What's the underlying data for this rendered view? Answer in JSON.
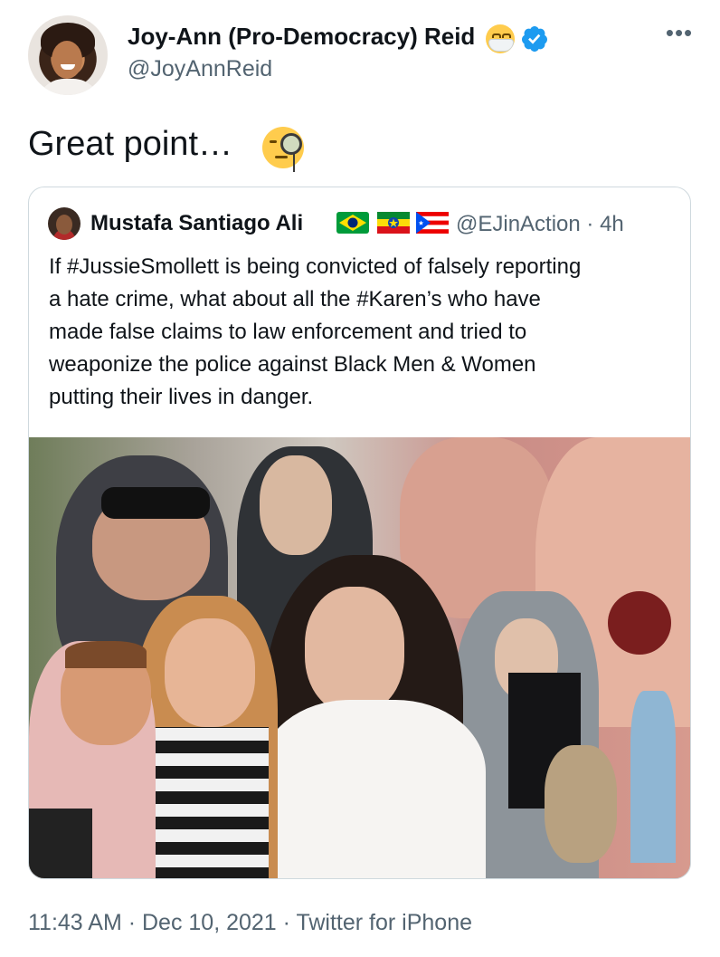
{
  "tweet": {
    "author_name": "Joy-Ann (Pro-Democracy) Reid",
    "author_handle": "@JoyAnnReid",
    "text": "Great point…",
    "timestamp": "11:43 AM · Dec 10, 2021 · Twitter for iPhone"
  },
  "quoted_tweet": {
    "author_name": "Mustafa Santiago Ali",
    "author_handle_time": "@EJinAction · 4h",
    "text_lines": [
      "If #JussieSmollett is being convicted of falsely reporting",
      "a hate crime, what about all the #Karen’s who have",
      "made false claims to law enforcement and tried to",
      "weaponize the police against Black Men & Women",
      "putting their lives in danger."
    ]
  },
  "colors": {
    "text_primary": "#0f1419",
    "text_secondary": "#536471",
    "verified_blue": "#1d9bf0",
    "border": "#cfd9de"
  },
  "icons": [
    "more-icon",
    "face-with-medical-mask-icon",
    "verified-badge-icon",
    "face-with-monocle-icon",
    "flag-brazil-icon",
    "flag-ethiopia-icon",
    "flag-puerto-rico-icon"
  ]
}
